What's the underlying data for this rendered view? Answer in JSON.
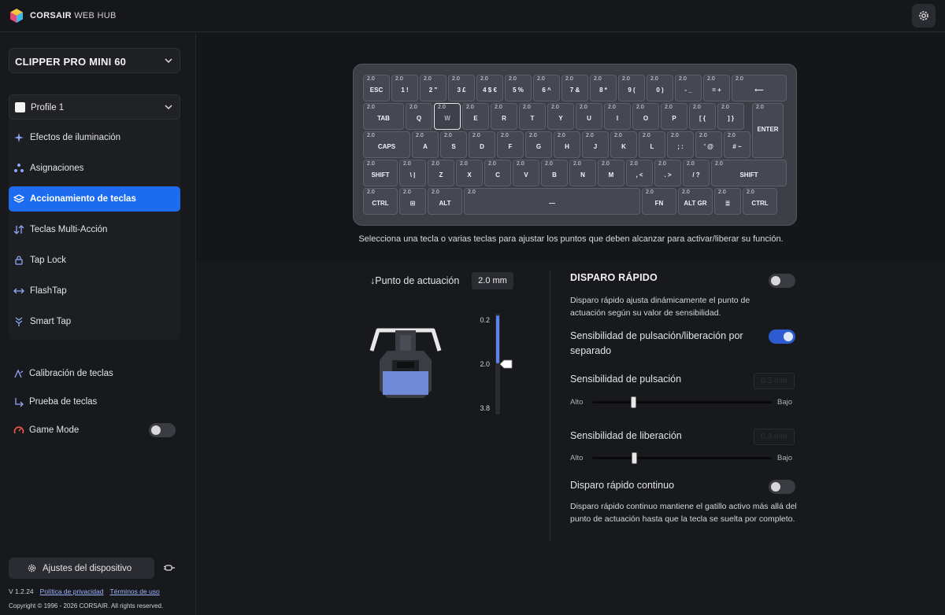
{
  "app": {
    "brand_bold": "CORSAIR",
    "brand_light": "WEB HUB"
  },
  "sidebar": {
    "device": "CLIPPER PRO MINI 60",
    "profile": "Profile 1",
    "items": [
      {
        "label": "Efectos de iluminación"
      },
      {
        "label": "Asignaciones"
      },
      {
        "label": "Accionamiento de teclas"
      },
      {
        "label": "Teclas Multi-Acción"
      },
      {
        "label": "Tap Lock"
      },
      {
        "label": "FlashTap"
      },
      {
        "label": "Smart Tap"
      }
    ],
    "tools": [
      {
        "label": "Calibración de teclas"
      },
      {
        "label": "Prueba de teclas"
      },
      {
        "label": "Game Mode"
      }
    ],
    "device_settings": "Ajustes del dispositivo",
    "version": "V 1.2.24",
    "privacy": "Política de privacidad",
    "terms": "Términos de uso",
    "copyright": "Copyright © 1996 - 2026 CORSAIR. All rights reserved."
  },
  "keyboard": {
    "value_label": "2.0",
    "rows": [
      [
        "ESC",
        "1 !",
        "2 \"",
        "3 £",
        "4 $ €",
        "5 %",
        "6 ^",
        "7 &",
        "8 *",
        "9 (",
        "0 )",
        "- _",
        "= +",
        "⟵"
      ],
      [
        "TAB",
        "Q",
        "W",
        "E",
        "R",
        "T",
        "Y",
        "U",
        "I",
        "O",
        "P",
        "[ {",
        "] }",
        "ENTER"
      ],
      [
        "CAPS",
        "A",
        "S",
        "D",
        "F",
        "G",
        "H",
        "J",
        "K",
        "L",
        "; :",
        "' @",
        "# ~"
      ],
      [
        "SHIFT",
        "\\ |",
        "Z",
        "X",
        "C",
        "V",
        "B",
        "N",
        "M",
        ", <",
        ". >",
        "/ ?",
        "SHIFT"
      ],
      [
        "CTRL",
        "⊞",
        "ALT",
        "—",
        "FN",
        "ALT GR",
        "≣",
        "CTRL"
      ]
    ]
  },
  "hint": "Selecciona una tecla o varias teclas para ajustar los puntos que deben alcanzar para activar/liberar su función.",
  "actuation": {
    "label": "Punto de actuación",
    "value": "2.0 mm",
    "ticks": [
      "0.2",
      "2.0",
      "3.8"
    ],
    "fraction": 0.5
  },
  "rapid": {
    "title": "DISPARO RÁPIDO",
    "enabled": false,
    "desc": "Disparo rápido ajusta dinámicamente el punto de actuación según su valor de sensibilidad.",
    "separate_label": "Sensibilidad de pulsación/liberación por separado",
    "separate_enabled": true,
    "press_label": "Sensibilidad de pulsación",
    "press_value": "0.3 mm",
    "release_label": "Sensibilidad de liberación",
    "release_value": "0.3 mm",
    "alto": "Alto",
    "bajo": "Bajo",
    "continuous_label": "Disparo rápido continuo",
    "continuous_enabled": false,
    "continuous_desc": "Disparo rápido continuo mantiene el gatillo activo más allá del punto de actuación hasta que la tecla se suelta por completo."
  },
  "colors": {
    "accent": "#1d6cf0",
    "fill": "#5b83ee"
  }
}
